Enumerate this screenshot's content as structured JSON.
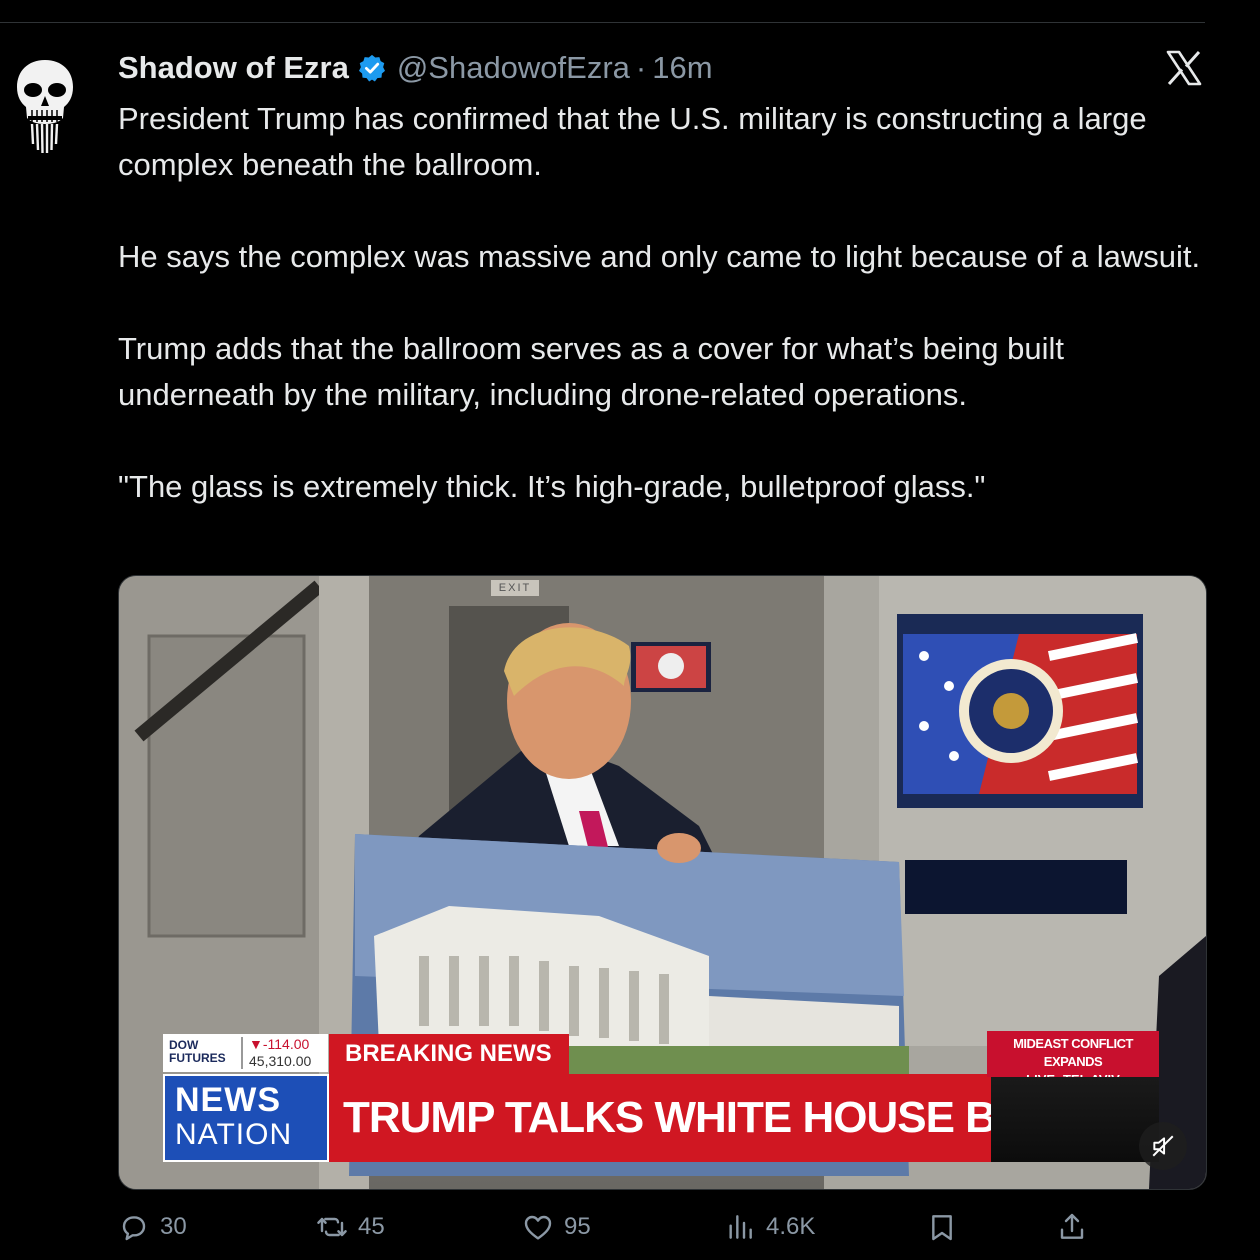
{
  "tweet": {
    "author_name": "Shadow of Ezra",
    "handle": "@ShadowofEzra",
    "separator": "·",
    "time": "16m",
    "paragraphs": [
      "President Trump has confirmed that the U.S. military is constructing a large complex beneath the ballroom.",
      "He says the complex was massive and only came to light because of a lawsuit.",
      "Trump adds that the ballroom serves as a cover for what’s being built underneath by the military, including drone-related operations.",
      "\"The glass is extremely thick. It’s high-grade, bulletproof glass.\""
    ]
  },
  "media": {
    "exit_sign": "EXIT",
    "ticker_label_1": "DOW",
    "ticker_label_2": "FUTURES",
    "ticker_change": "▼-114.00",
    "ticker_value": "45,310.00",
    "breaking": "BREAKING NEWS",
    "logo_line1": "NEWS",
    "logo_line2": "NATION",
    "headline": "TRUMP TALKS WHITE HOUSE BALLROOM",
    "side_line1": "MIDEAST CONFLICT EXPANDS",
    "side_line2": "LIVE: TEL AVIV"
  },
  "actions": {
    "replies": "30",
    "reposts": "45",
    "likes": "95",
    "views": "4.6K"
  },
  "colors": {
    "background": "#000000",
    "text": "#e7e9ea",
    "secondary": "#8b98a5",
    "verified": "#1d9bf0",
    "news_red": "#d01722",
    "news_blue": "#1d4fb7"
  },
  "icons": [
    "punisher-skull-avatar",
    "verified-badge-icon",
    "x-logo-icon",
    "mute-icon",
    "reply-icon",
    "repost-icon",
    "like-icon",
    "views-icon",
    "bookmark-icon",
    "share-icon"
  ]
}
